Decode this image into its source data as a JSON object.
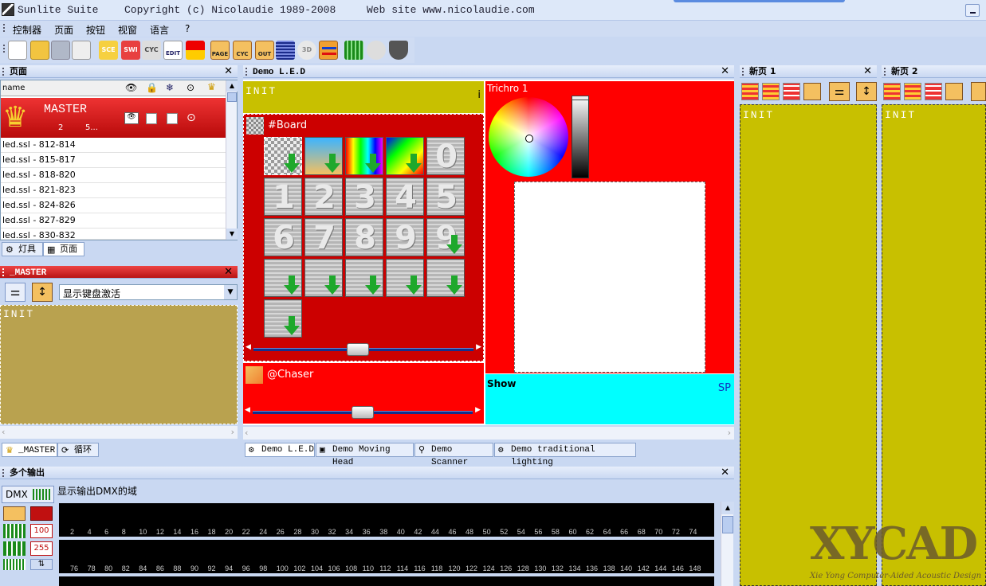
{
  "app": {
    "title_name": "Sunlite Suite",
    "title_copyright": "Copyright (c) Nicolaudie 1989-2008",
    "title_website": "Web site www.nicolaudie.com"
  },
  "menu": [
    "控制器",
    "页面",
    "按钮",
    "视窗",
    "语言",
    "?"
  ],
  "toolbar": {
    "icons": [
      "new-icon",
      "open-icon",
      "save-icon",
      "copy-icon",
      "scene-icon",
      "switch-icon",
      "cycle-icon",
      "edit-icon",
      "flag-icon",
      "page-icon",
      "cycle-page-icon",
      "output-icon",
      "dmx-icon",
      "3d-icon",
      "swap-icon",
      "timeline-icon",
      "music-icon",
      "fixture-icon"
    ],
    "labels": {
      "scene": "SCE",
      "switch": "SWI",
      "cycle": "CYC",
      "edit": "EDIT",
      "page": "PAGE",
      "cyc": "CYC",
      "out": "OUT",
      "threed": "3D"
    }
  },
  "pages_panel": {
    "title": "页面",
    "col_name": "name",
    "master": {
      "name": "MASTER",
      "count": "2",
      "extra": "5..."
    },
    "rows": [
      "led.ssl - 812-814",
      "led.ssl - 815-817",
      "led.ssl - 818-820",
      "led.ssl - 821-823",
      "led.ssl - 824-826",
      "led.ssl - 827-829",
      "led.ssl - 830-832"
    ],
    "tabs": [
      "灯具",
      "页面"
    ]
  },
  "master_panel": {
    "title": "_MASTER",
    "dropdown_value": "显示键盘激活",
    "init_label": "INIT",
    "tabs": [
      "_MASTER",
      "循环"
    ]
  },
  "demo_led": {
    "title": "Demo L.E.D",
    "init_label": "INIT",
    "init_flag": "i",
    "board_title": "#Board",
    "board_digits": [
      "0",
      "1",
      "2",
      "3",
      "4",
      "5",
      "6",
      "7",
      "8",
      "9",
      "9"
    ],
    "chaser_title": "@Chaser",
    "trichro_title": "Trichro 1",
    "show_label": "Show",
    "show_flag": "SP",
    "tabs": [
      "Demo L.E.D",
      "Demo Moving Head",
      "Demo Scanner",
      "Demo traditional lighting"
    ],
    "slider_board_pos": 0.47,
    "slider_chaser_pos": 0.5,
    "colors": {
      "red": "#ff0000",
      "olive": "#c8c000",
      "cyan": "#00ffff",
      "board_red": "#cc0000"
    }
  },
  "page1": {
    "title": "新页 1",
    "init_label": "INIT"
  },
  "page2": {
    "title": "新页 2",
    "init_label": "INIT"
  },
  "output_panel": {
    "title": "多个输出",
    "dmx_label": "DMX",
    "description": "显示输出DMX的域",
    "side_labels": [
      "100",
      "255"
    ],
    "row1": [
      "2",
      "4",
      "6",
      "8",
      "10",
      "12",
      "14",
      "16",
      "18",
      "20",
      "22",
      "24",
      "26",
      "28",
      "30",
      "32",
      "34",
      "36",
      "38",
      "40",
      "42",
      "44",
      "46",
      "48",
      "50",
      "52",
      "54",
      "56",
      "58",
      "60",
      "62",
      "64",
      "66",
      "68",
      "70",
      "72",
      "74"
    ],
    "row2": [
      "76",
      "78",
      "80",
      "82",
      "84",
      "86",
      "88",
      "90",
      "92",
      "94",
      "96",
      "98",
      "100",
      "102",
      "104",
      "106",
      "108",
      "110",
      "112",
      "114",
      "116",
      "118",
      "120",
      "122",
      "124",
      "126",
      "128",
      "130",
      "132",
      "134",
      "136",
      "138",
      "140",
      "142",
      "144",
      "146",
      "148"
    ]
  },
  "watermark": {
    "logo": "XYCAD",
    "tagline": "Xie Yong Computer-Aided Acoustic Design"
  }
}
